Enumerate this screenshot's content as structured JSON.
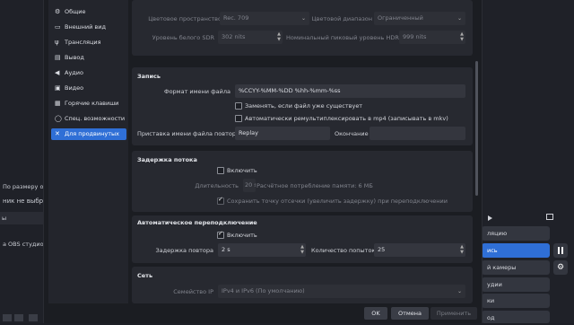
{
  "background_window": {
    "left_texts": {
      "fit": "По размеру окна",
      "not_selected": "ник не выбран",
      "section": "ы",
      "studio": "а OBS студио у"
    },
    "right_buttons": {
      "broadcast": "ляцию",
      "record": "ись",
      "camera": "й камеры",
      "studio": "удии",
      "settings": "ки",
      "exit": "од"
    }
  },
  "sidebar": {
    "items": [
      {
        "icon": "gear-icon",
        "glyph": "⚙",
        "label": "Общие"
      },
      {
        "icon": "monitor-icon",
        "glyph": "▭",
        "label": "Внешний вид"
      },
      {
        "icon": "broadcast-icon",
        "glyph": "ψ",
        "label": "Трансляция"
      },
      {
        "icon": "output-icon",
        "glyph": "▤",
        "label": "Вывод"
      },
      {
        "icon": "speaker-icon",
        "glyph": "◀",
        "label": "Аудио"
      },
      {
        "icon": "video-icon",
        "glyph": "▣",
        "label": "Видео"
      },
      {
        "icon": "keyboard-icon",
        "glyph": "▦",
        "label": "Горячие клавиши"
      },
      {
        "icon": "accessibility-icon",
        "glyph": "◯",
        "label": "Спец. возможности"
      },
      {
        "icon": "tools-icon",
        "glyph": "✕",
        "label": "Для продвинутых"
      }
    ],
    "active_index": 8
  },
  "video_top": {
    "color_space_label": "Цветовое пространство",
    "color_space_value": "Rec. 709",
    "color_range_label": "Цветовой диапазон",
    "color_range_value": "Ограниченный",
    "sdr_white_label": "Уровень белого SDR",
    "sdr_white_value": "302 nits",
    "hdr_peak_label": "Номинальный пиковый уровень HDR",
    "hdr_peak_value": "999 nits"
  },
  "recording": {
    "title": "Запись",
    "filename_format_label": "Формат имени файла",
    "filename_format_value": "%CCYY-%MM-%DD %hh-%mm-%ss",
    "overwrite_label": "Заменять, если файл уже существует",
    "overwrite_checked": false,
    "remux_label": "Автоматически ремультиплексировать в mp4 (записывать в mkv)",
    "remux_checked": false,
    "replay_prefix_label": "Приставка имени файла повтора",
    "replay_prefix_value": "Replay",
    "suffix_label": "Окончание",
    "suffix_value": ""
  },
  "stream_delay": {
    "title": "Задержка потока",
    "enable_label": "Включить",
    "enable_checked": false,
    "duration_label": "Длительность",
    "duration_value": "20 s",
    "memory_text": "Расчётное потребление памяти: 6 МБ",
    "preserve_label": "Сохранить точку отсечки (увеличить задержку) при переподключении",
    "preserve_checked": true
  },
  "reconnect": {
    "title": "Автоматическое переподключение",
    "enable_label": "Включить",
    "enable_checked": true,
    "retry_delay_label": "Задержка повтора",
    "retry_delay_value": "2 s",
    "max_retries_label": "Количество попыток",
    "max_retries_value": "25"
  },
  "network": {
    "title": "Сеть",
    "ip_family_label": "Семейство IP",
    "ip_family_value": "IPv4 и IPv6 (По умолчанию)"
  },
  "footer": {
    "ok": "OK",
    "cancel": "Отмена",
    "apply": "Применить"
  },
  "colors": {
    "accent": "#2f6fd6",
    "panel": "#272930",
    "dialog": "#1b1d22"
  }
}
